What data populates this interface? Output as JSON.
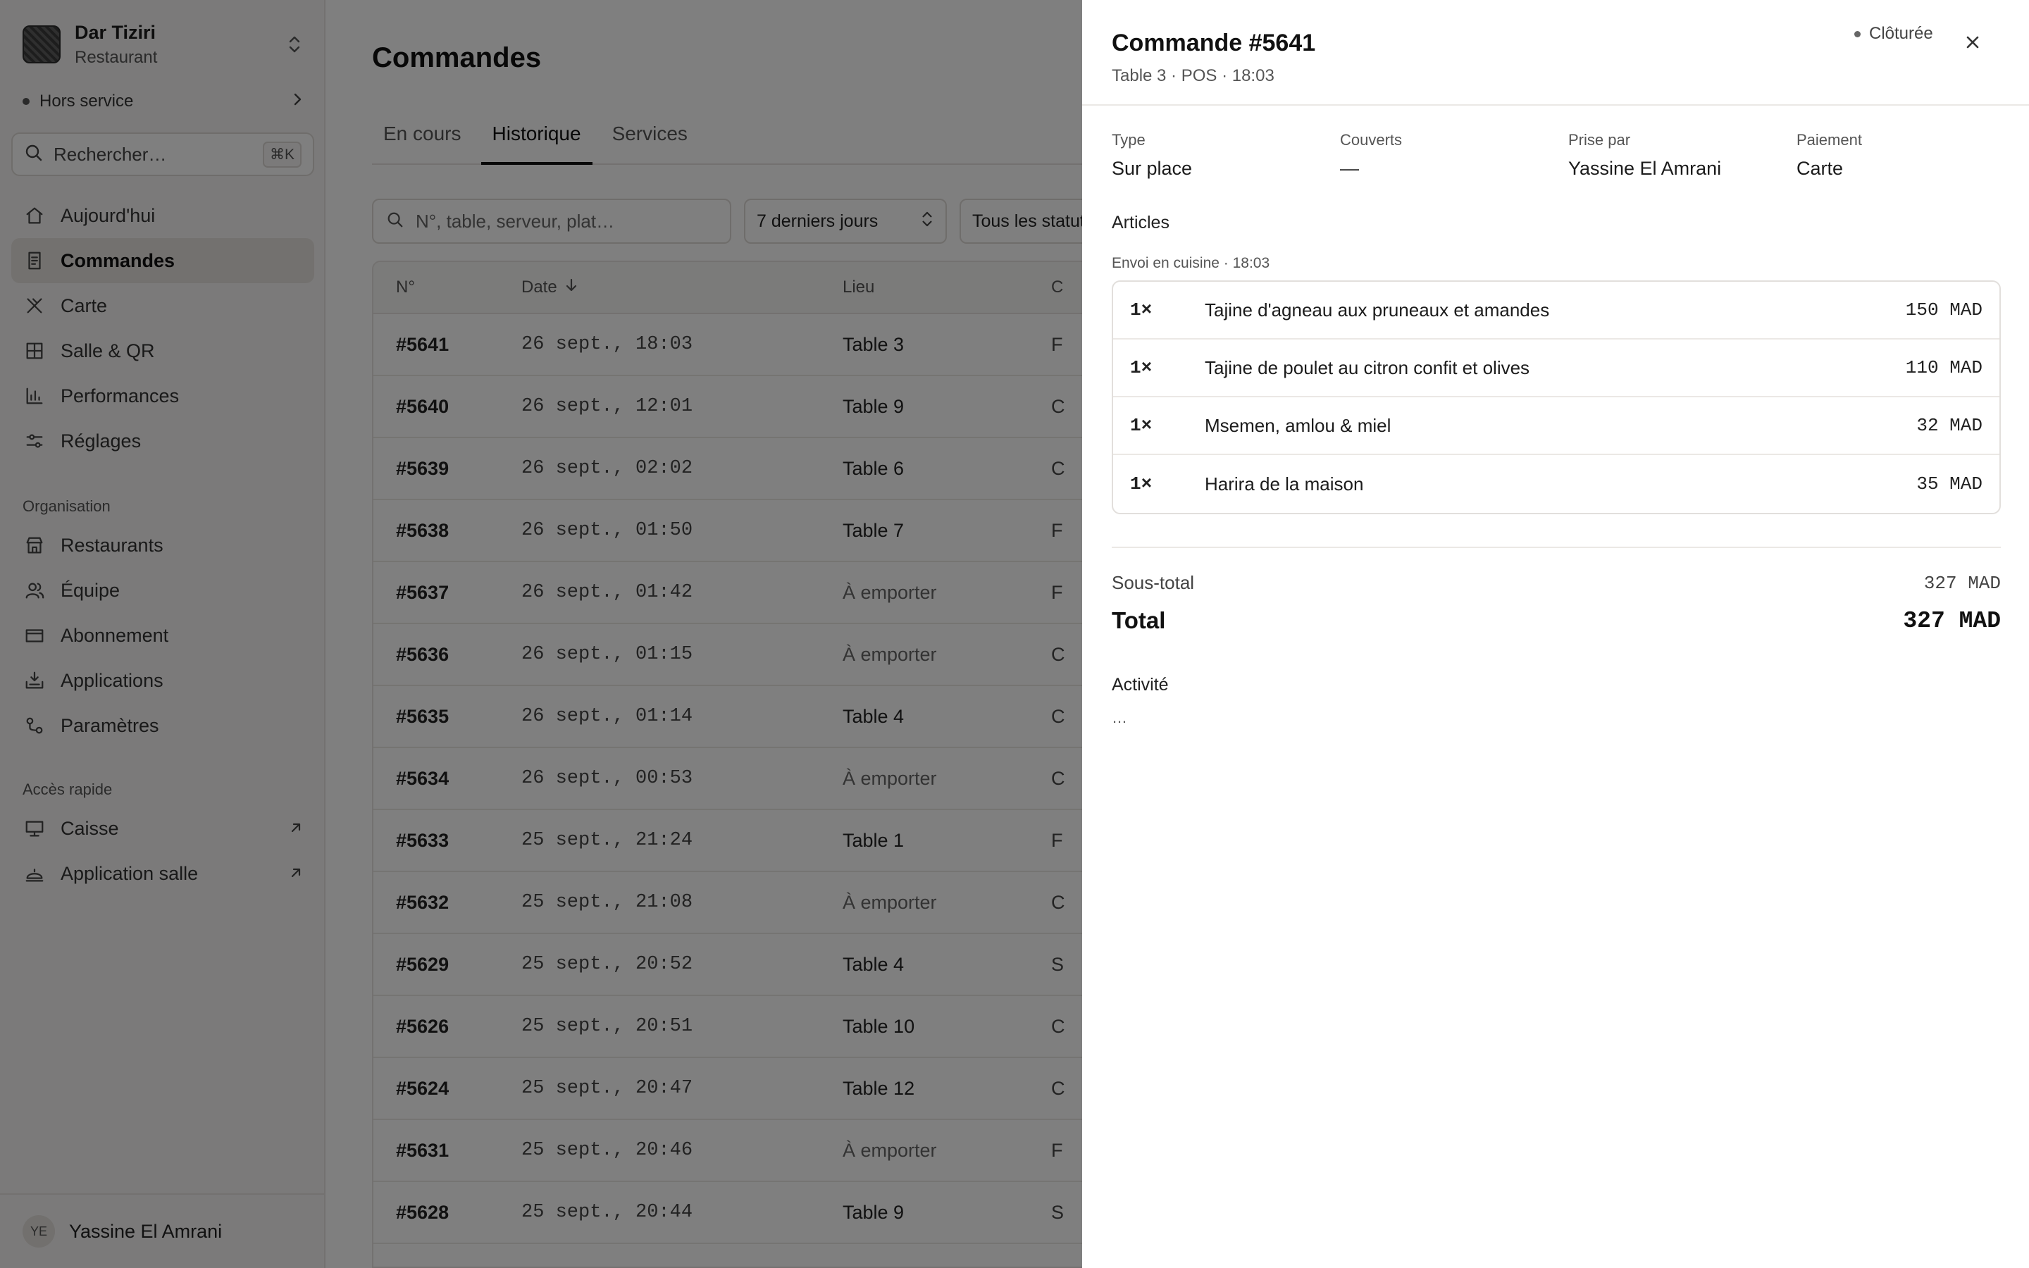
{
  "workspace": {
    "name": "Dar Tiziri",
    "type": "Restaurant"
  },
  "service_status": "Hors service",
  "sidebar_search": {
    "placeholder": "Rechercher…",
    "shortcut": "⌘K"
  },
  "nav_main": [
    {
      "label": "Aujourd'hui",
      "icon": "home-icon"
    },
    {
      "label": "Commandes",
      "icon": "receipt-icon",
      "active": true
    },
    {
      "label": "Carte",
      "icon": "utensils-icon"
    },
    {
      "label": "Salle & QR",
      "icon": "grid-icon"
    },
    {
      "label": "Performances",
      "icon": "bar-chart-icon"
    },
    {
      "label": "Réglages",
      "icon": "sliders-icon"
    }
  ],
  "org_section_label": "Organisation",
  "nav_org": [
    {
      "label": "Restaurants",
      "icon": "store-icon"
    },
    {
      "label": "Équipe",
      "icon": "users-icon"
    },
    {
      "label": "Abonnement",
      "icon": "credit-card-icon"
    },
    {
      "label": "Applications",
      "icon": "apps-icon"
    },
    {
      "label": "Paramètres",
      "icon": "settings-icon"
    }
  ],
  "quick_section_label": "Accès rapide",
  "nav_quick": [
    {
      "label": "Caisse",
      "icon": "monitor-icon"
    },
    {
      "label": "Application salle",
      "icon": "cloche-icon"
    }
  ],
  "user": {
    "initials": "YE",
    "name": "Yassine El Amrani"
  },
  "page": {
    "title": "Commandes",
    "tabs": [
      "En cours",
      "Historique",
      "Services"
    ],
    "active_tab": "Historique",
    "search_placeholder": "N°, table, serveur, plat…",
    "period_filter": "7 derniers jours",
    "status_filter": "Tous les statuts"
  },
  "orders_table": {
    "columns": [
      "N°",
      "Date",
      "Lieu",
      "C"
    ],
    "rows": [
      {
        "num": "#5641",
        "date": "26 sept., 18:03",
        "lieu": "Table 3",
        "col4": "F"
      },
      {
        "num": "#5640",
        "date": "26 sept., 12:01",
        "lieu": "Table 9",
        "col4": "C"
      },
      {
        "num": "#5639",
        "date": "26 sept., 02:02",
        "lieu": "Table 6",
        "col4": "C"
      },
      {
        "num": "#5638",
        "date": "26 sept., 01:50",
        "lieu": "Table 7",
        "col4": "F"
      },
      {
        "num": "#5637",
        "date": "26 sept., 01:42",
        "lieu": "À emporter",
        "col4": "F"
      },
      {
        "num": "#5636",
        "date": "26 sept., 01:15",
        "lieu": "À emporter",
        "col4": "C"
      },
      {
        "num": "#5635",
        "date": "26 sept., 01:14",
        "lieu": "Table 4",
        "col4": "C"
      },
      {
        "num": "#5634",
        "date": "26 sept., 00:53",
        "lieu": "À emporter",
        "col4": "C"
      },
      {
        "num": "#5633",
        "date": "25 sept., 21:24",
        "lieu": "Table 1",
        "col4": "F"
      },
      {
        "num": "#5632",
        "date": "25 sept., 21:08",
        "lieu": "À emporter",
        "col4": "C"
      },
      {
        "num": "#5629",
        "date": "25 sept., 20:52",
        "lieu": "Table 4",
        "col4": "S"
      },
      {
        "num": "#5626",
        "date": "25 sept., 20:51",
        "lieu": "Table 10",
        "col4": "C"
      },
      {
        "num": "#5624",
        "date": "25 sept., 20:47",
        "lieu": "Table 12",
        "col4": "C"
      },
      {
        "num": "#5631",
        "date": "25 sept., 20:46",
        "lieu": "À emporter",
        "col4": "F"
      },
      {
        "num": "#5628",
        "date": "25 sept., 20:44",
        "lieu": "Table 9",
        "col4": "S"
      }
    ]
  },
  "drawer": {
    "title": "Commande #5641",
    "subtitle": "Table 3 · POS · 18:03",
    "status": "Clôturée",
    "meta": [
      {
        "label": "Type",
        "value": "Sur place"
      },
      {
        "label": "Couverts",
        "value": "—"
      },
      {
        "label": "Prise par",
        "value": "Yassine El Amrani"
      },
      {
        "label": "Paiement",
        "value": "Carte"
      }
    ],
    "articles_label": "Articles",
    "batch_label": "Envoi en cuisine · 18:03",
    "items": [
      {
        "qty": "1×",
        "name": "Tajine d'agneau aux pruneaux et amandes",
        "price": "150 MAD"
      },
      {
        "qty": "1×",
        "name": "Tajine de poulet au citron confit et olives",
        "price": "110 MAD"
      },
      {
        "qty": "1×",
        "name": "Msemen, amlou & miel",
        "price": "32 MAD"
      },
      {
        "qty": "1×",
        "name": "Harira de la maison",
        "price": "35 MAD"
      }
    ],
    "subtotal_label": "Sous-total",
    "subtotal_value": "327 MAD",
    "total_label": "Total",
    "total_value": "327 MAD",
    "activity_label": "Activité",
    "activity_value": "…"
  }
}
